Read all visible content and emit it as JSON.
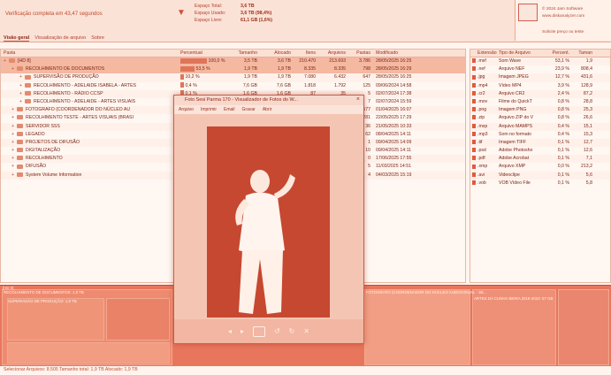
{
  "header": {
    "verification": "Verificação completa em 43,47 segundos",
    "space": [
      {
        "label": "Espaço Total:",
        "value": "3,6 TB"
      },
      {
        "label": "Espaço Usado:",
        "value": "3,6 TB  (98,4%)"
      },
      {
        "label": "Espaço Livre:",
        "value": "61,1 GB  (1,6%)"
      }
    ],
    "promo": [
      "© 2024 Jam Software",
      "www.diskanalyzer.com",
      "Solicite preço ou teste"
    ]
  },
  "tabs": [
    "Visão geral",
    "Visualização de arquivo",
    "Sobre"
  ],
  "tree": {
    "columns": [
      "Pasta",
      "Percentual",
      "Tamanho",
      "Alocado",
      "Itens",
      "Arquivos",
      "Pastas",
      "Modificado"
    ],
    "rows": [
      {
        "name": "[HD 8]",
        "pct": "100,0 %",
        "size": "3,5 TB",
        "alloc": "3,6 TB",
        "items": "210.470",
        "files": "213.693",
        "folders": "3.786",
        "mod": "28/05/2025 16:25",
        "level": 0,
        "sel": true
      },
      {
        "name": "RECOLHIMENTO DE DOCUMENTOS",
        "pct": "53,5 %",
        "size": "1,9 TB",
        "alloc": "1,9 TB",
        "items": "8.335",
        "files": "8.335",
        "folders": "798",
        "mod": "28/05/2025 16:29",
        "level": 1,
        "sel": true
      },
      {
        "name": "SUPERVISÃO DE PRODUÇÃO",
        "pct": "10,2 %",
        "size": "1,9 TB",
        "alloc": "1,9 TB",
        "items": "7.080",
        "files": "6.432",
        "folders": "647",
        "mod": "28/05/2025 16:25",
        "level": 2
      },
      {
        "name": "RECOLHIMENTO - ADELAIDE ISABELA - ARTES",
        "pct": "0,4 %",
        "size": "7,6 GB",
        "alloc": "7,6 GB",
        "items": "1.818",
        "files": "1.792",
        "folders": "125",
        "mod": "09/06/2024 14:58",
        "level": 2
      },
      {
        "name": "RECOLHIMENTO - RÁDIO CCSP",
        "pct": "0,1 %",
        "size": "1,6 GB",
        "alloc": "1,6 GB",
        "items": "87",
        "files": "35",
        "folders": "5",
        "mod": "02/07/2024 17:38",
        "level": 2
      },
      {
        "name": "RECOLHIMENTO - ADELAIDE - ARTES VISUAIS",
        "pct": "0,0 %",
        "size": "1,1 GB",
        "alloc": "1,1 GB",
        "items": "9",
        "files": "9",
        "folders": "7",
        "mod": "02/07/2024 15:59",
        "level": 2
      },
      {
        "name": "FOTOGRAFO (COORDENADOR DO NÚCLEO AU",
        "pct": "",
        "size": "",
        "alloc": "",
        "items": "",
        "files": "",
        "folders": "4.577",
        "mod": "01/04/2025 16:07",
        "level": 1
      },
      {
        "name": "RECOLHIMENTO TESTE - ARTES VISUAIS (BRASI",
        "pct": "",
        "size": "",
        "alloc": "",
        "items": "",
        "files": "",
        "folders": "281",
        "mod": "22/05/2025 17:29",
        "level": 1
      },
      {
        "name": "SERVIDOR SSS",
        "pct": "",
        "size": "",
        "alloc": "",
        "items": "",
        "files": "",
        "folders": "36",
        "mod": "21/05/2025 10:33",
        "level": 1
      },
      {
        "name": "LEGADO",
        "pct": "",
        "size": "",
        "alloc": "",
        "items": "",
        "files": "",
        "folders": "62",
        "mod": "08/04/2025 14:11",
        "level": 1
      },
      {
        "name": "PROJETOS DE DIFUSÃO",
        "pct": "",
        "size": "",
        "alloc": "",
        "items": "",
        "files": "",
        "folders": "1",
        "mod": "09/04/2025 14:09",
        "level": 1
      },
      {
        "name": "DIGITALIZAÇÃO",
        "pct": "",
        "size": "",
        "alloc": "",
        "items": "",
        "files": "",
        "folders": "10",
        "mod": "09/04/2025 14:11",
        "level": 1
      },
      {
        "name": "RECOLHIMENTO",
        "pct": "",
        "size": "",
        "alloc": "",
        "items": "",
        "files": "",
        "folders": "0",
        "mod": "17/06/2025 17:55",
        "level": 1
      },
      {
        "name": "DIFUSÃO",
        "pct": "",
        "size": "",
        "alloc": "",
        "items": "",
        "files": "",
        "folders": "5",
        "mod": "11/03/2025 14:51",
        "level": 1
      },
      {
        "name": "System Volume Information",
        "pct": "",
        "size": "",
        "alloc": "",
        "items": "",
        "files": "",
        "folders": "4",
        "mod": "04/03/2025 15:19",
        "level": 1
      }
    ]
  },
  "extensions": {
    "columns": [
      "Extensão",
      "Tipo de Arquivo",
      "Percent.",
      "Taman"
    ],
    "rows": [
      {
        "ext": ".mxf",
        "type": "Som Wave",
        "pct": "53,1 %",
        "size": "1,9"
      },
      {
        "ext": ".nef",
        "type": "Arquivo NEF",
        "pct": "23,9 %",
        "size": "808,4"
      },
      {
        "ext": ".jpg",
        "type": "Imagem JPEG",
        "pct": "12,7 %",
        "size": "431,6"
      },
      {
        "ext": ".mp4",
        "type": "Vídeo MP4",
        "pct": "3,9 %",
        "size": "128,9"
      },
      {
        "ext": ".cr2",
        "type": "Arquivo CR2",
        "pct": "2,4 %",
        "size": "87,2"
      },
      {
        "ext": ".mov",
        "type": "Filme do QuickT",
        "pct": "0,8 %",
        "size": "28,8"
      },
      {
        "ext": ".png",
        "type": "Imagem PNG",
        "pct": "0,8 %",
        "size": "25,3"
      },
      {
        "ext": ".zip",
        "type": "Arquivo ZIP do V",
        "pct": "0,8 %",
        "size": "26,6"
      },
      {
        "ext": ".mxp",
        "type": "Arquivo MAMPS",
        "pct": "0,4 %",
        "size": "15,1"
      },
      {
        "ext": ".mp3",
        "type": "Som no formato",
        "pct": "0,4 %",
        "size": "15,3"
      },
      {
        "ext": ".tif",
        "type": "Imagem TIFF",
        "pct": "0,1 %",
        "size": "12,7"
      },
      {
        "ext": ".psd",
        "type": "Adobe Photosho",
        "pct": "0,1 %",
        "size": "12,6"
      },
      {
        "ext": ".pdf",
        "type": "Adobe Acrobat",
        "pct": "0,1 %",
        "size": "7,1"
      },
      {
        "ext": ".xmp",
        "type": "Arquivo XMP",
        "pct": "0,0 %",
        "size": "213,2"
      },
      {
        "ext": ".avi",
        "type": "Videoclipe",
        "pct": "0,1 %",
        "size": "5,6"
      },
      {
        "ext": ".vob",
        "type": "VOB Vídeo File",
        "pct": "0,1 %",
        "size": "5,8"
      }
    ]
  },
  "treemap": {
    "labels": [
      "[HD 8]",
      "RECOLHIMENTO DE DOCUMENTOS: 1,9 TB",
      "SUPERVISÃO DE PRODUÇÃO: 1,9 TB",
      "FOTOGRAFO (COORDENADOR DO NÚCLEO AUDIOVISUAL - SE...",
      "ARTES DA CUNHA BEIRA 2019-2023: 57 GB"
    ]
  },
  "viewer": {
    "title": "Foto Sesi Parma 170 - Visualizador de Fotos do W...",
    "menu": [
      "Arquivo",
      "Imprimir",
      "Email",
      "Gravar",
      "Abrir"
    ],
    "close": "×"
  },
  "status": "Selecionar Arquivos: 8.505  Tamanho total: 1,9 TB  Alocado: 1,9 TB"
}
